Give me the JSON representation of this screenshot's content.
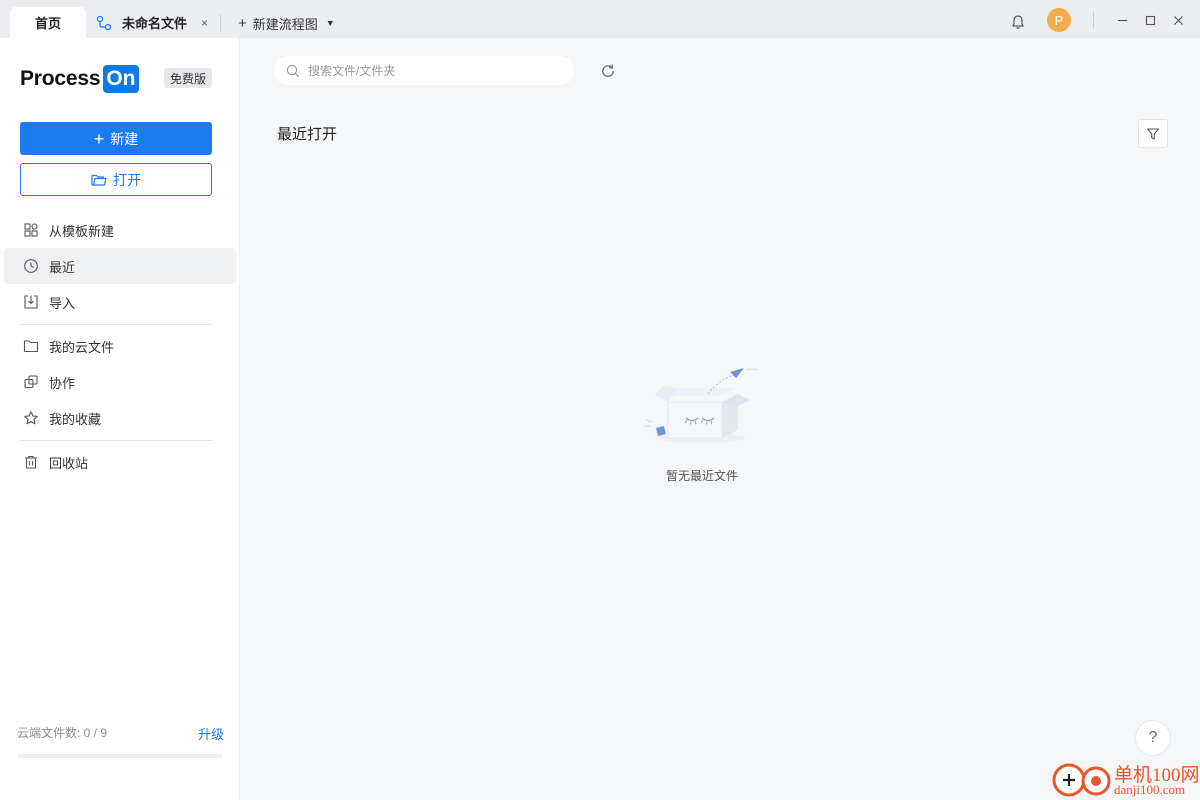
{
  "tabs": {
    "home": "首页",
    "file": "未命名文件",
    "close": "×",
    "new_flow": "新建流程图"
  },
  "user": {
    "avatar_initial": "P"
  },
  "window_controls": {
    "minimize": "—",
    "maximize": "☐",
    "close": "✕"
  },
  "sidebar": {
    "logo_text": "Process",
    "logo_badge": "On",
    "plan_badge": "免费版",
    "new_button": "新建",
    "open_button": "打开",
    "items": [
      {
        "label": "从模板新建",
        "icon": "template-icon"
      },
      {
        "label": "最近",
        "icon": "clock-icon"
      },
      {
        "label": "导入",
        "icon": "import-icon"
      },
      {
        "label": "我的云文件",
        "icon": "folder-icon"
      },
      {
        "label": "协作",
        "icon": "collaborate-icon"
      },
      {
        "label": "我的收藏",
        "icon": "star-icon"
      },
      {
        "label": "回收站",
        "icon": "trash-icon"
      }
    ],
    "active_item": "最近",
    "quota_label": "云端文件数: 0 / 9",
    "quota_used": 0,
    "quota_total": 9,
    "upgrade": "升级"
  },
  "main": {
    "search_placeholder": "搜索文件/文件夹",
    "section_title": "最近打开",
    "empty_text": "暂无最近文件",
    "help": "?"
  },
  "watermark": {
    "text_cn": "单机100网",
    "text_url": "danji100.com"
  },
  "colors": {
    "accent": "#1a7cf0",
    "avatar": "#f4ad4d",
    "watermark": "#e8572a"
  }
}
